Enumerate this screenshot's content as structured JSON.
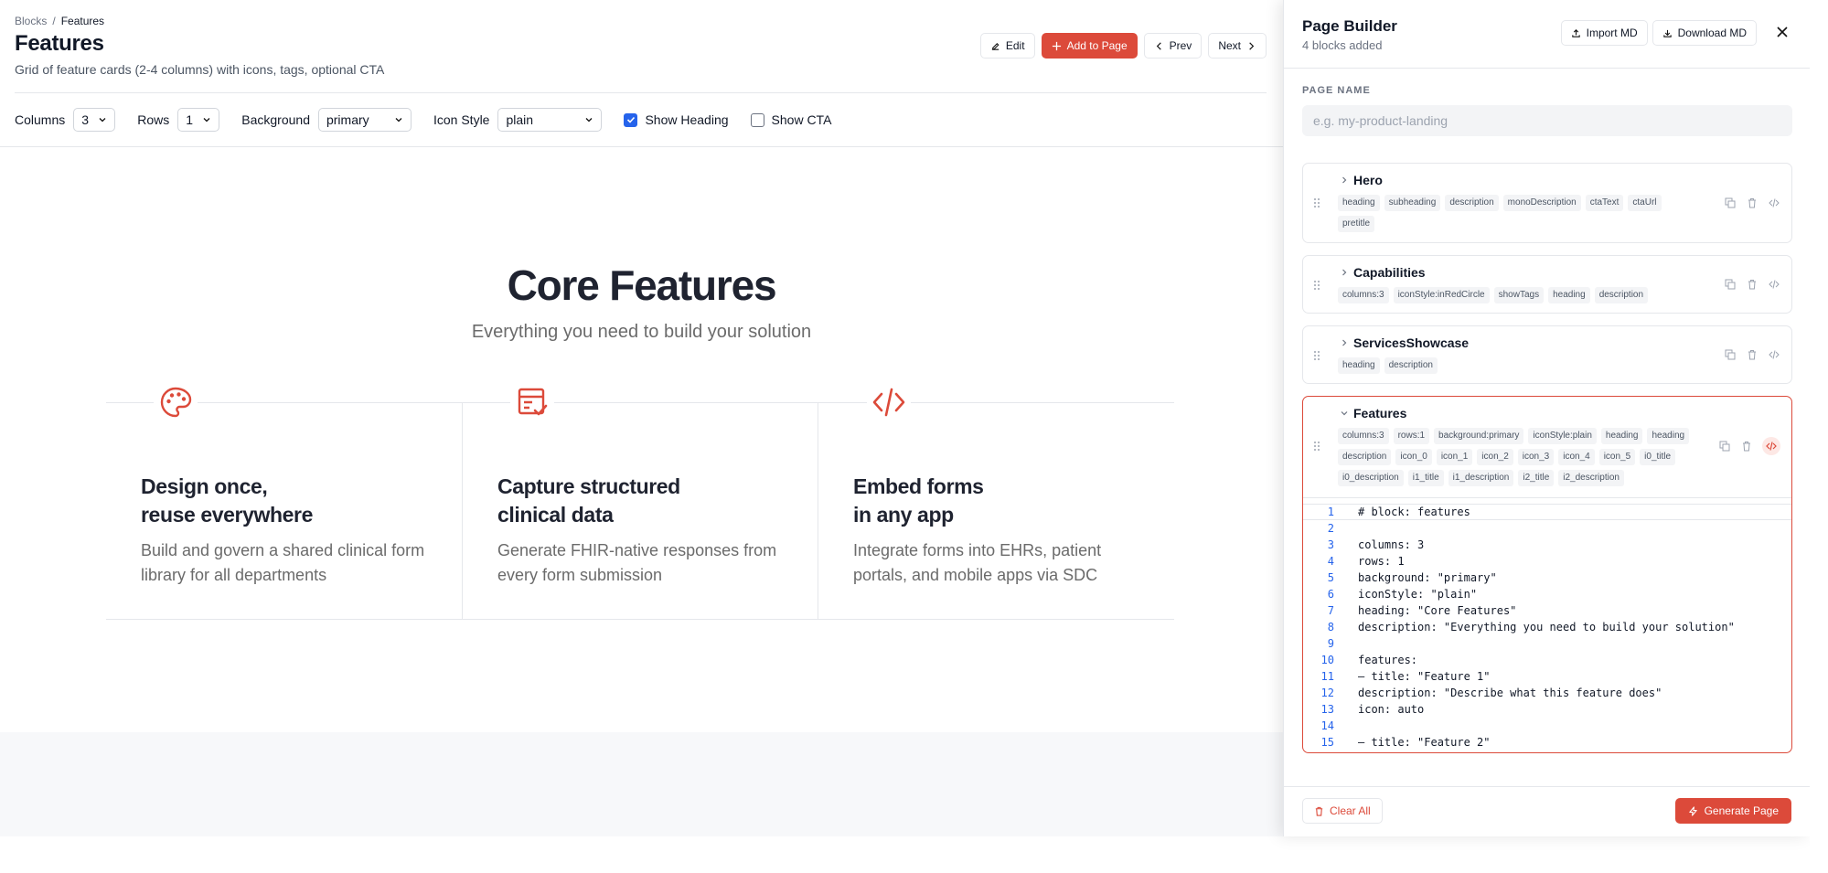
{
  "breadcrumb": {
    "root": "Blocks",
    "separator": "/",
    "current": "Features"
  },
  "page": {
    "title": "Features",
    "subtitle": "Grid of feature cards (2-4 columns) with icons, tags, optional CTA"
  },
  "top_actions": {
    "edit": "Edit",
    "add": "Add to Page",
    "prev": "Prev",
    "next": "Next"
  },
  "controls": {
    "columns_label": "Columns",
    "columns_value": "3",
    "rows_label": "Rows",
    "rows_value": "1",
    "background_label": "Background",
    "background_value": "primary",
    "icon_style_label": "Icon Style",
    "icon_style_value": "plain",
    "show_heading_label": "Show Heading",
    "show_heading_checked": true,
    "show_cta_label": "Show CTA",
    "show_cta_checked": false
  },
  "preview": {
    "heading": "Core Features",
    "description": "Everything you need to build your solution",
    "accent_color": "#dc4a3a",
    "features": [
      {
        "icon": "palette-icon",
        "title": "Design once,\nreuse everywhere",
        "description": "Build and govern a shared clinical form library for all departments"
      },
      {
        "icon": "form-check-icon",
        "title": "Capture structured\nclinical data",
        "description": "Generate FHIR-native responses from every form submission"
      },
      {
        "icon": "code-icon",
        "title": "Embed forms\nin any app",
        "description": "Integrate forms into EHRs, patient portals, and mobile apps via SDC"
      }
    ]
  },
  "panel": {
    "title": "Page Builder",
    "subtitle": "4 blocks added",
    "import_label": "Import MD",
    "download_label": "Download MD",
    "page_name_label": "PAGE NAME",
    "page_name_placeholder": "e.g. my-product-landing",
    "blocks": [
      {
        "name": "Hero",
        "tags": [
          "heading",
          "subheading",
          "description",
          "monoDescription",
          "ctaText",
          "ctaUrl",
          "pretitle"
        ]
      },
      {
        "name": "Capabilities",
        "tags": [
          "columns:3",
          "iconStyle:inRedCircle",
          "showTags",
          "heading",
          "description"
        ]
      },
      {
        "name": "ServicesShowcase",
        "tags": [
          "heading",
          "description"
        ]
      },
      {
        "name": "Features",
        "tags": [
          "columns:3",
          "rows:1",
          "background:primary",
          "iconStyle:plain",
          "heading",
          "heading",
          "description",
          "icon_0",
          "icon_1",
          "icon_2",
          "icon_3",
          "icon_4",
          "icon_5",
          "i0_title",
          "i0_description",
          "i1_title",
          "i1_description",
          "i2_title",
          "i2_description"
        ]
      }
    ],
    "code_lines": [
      "# block: features",
      "",
      "columns: 3",
      "rows: 1",
      "background: \"primary\"",
      "iconStyle: \"plain\"",
      "heading: \"Core Features\"",
      "description: \"Everything you need to build your solution\"",
      "",
      "features:",
      "– title: \"Feature 1\"",
      "description: \"Describe what this feature does\"",
      "icon: auto",
      "",
      "– title: \"Feature 2\""
    ],
    "clear_label": "Clear All",
    "generate_label": "Generate Page"
  }
}
